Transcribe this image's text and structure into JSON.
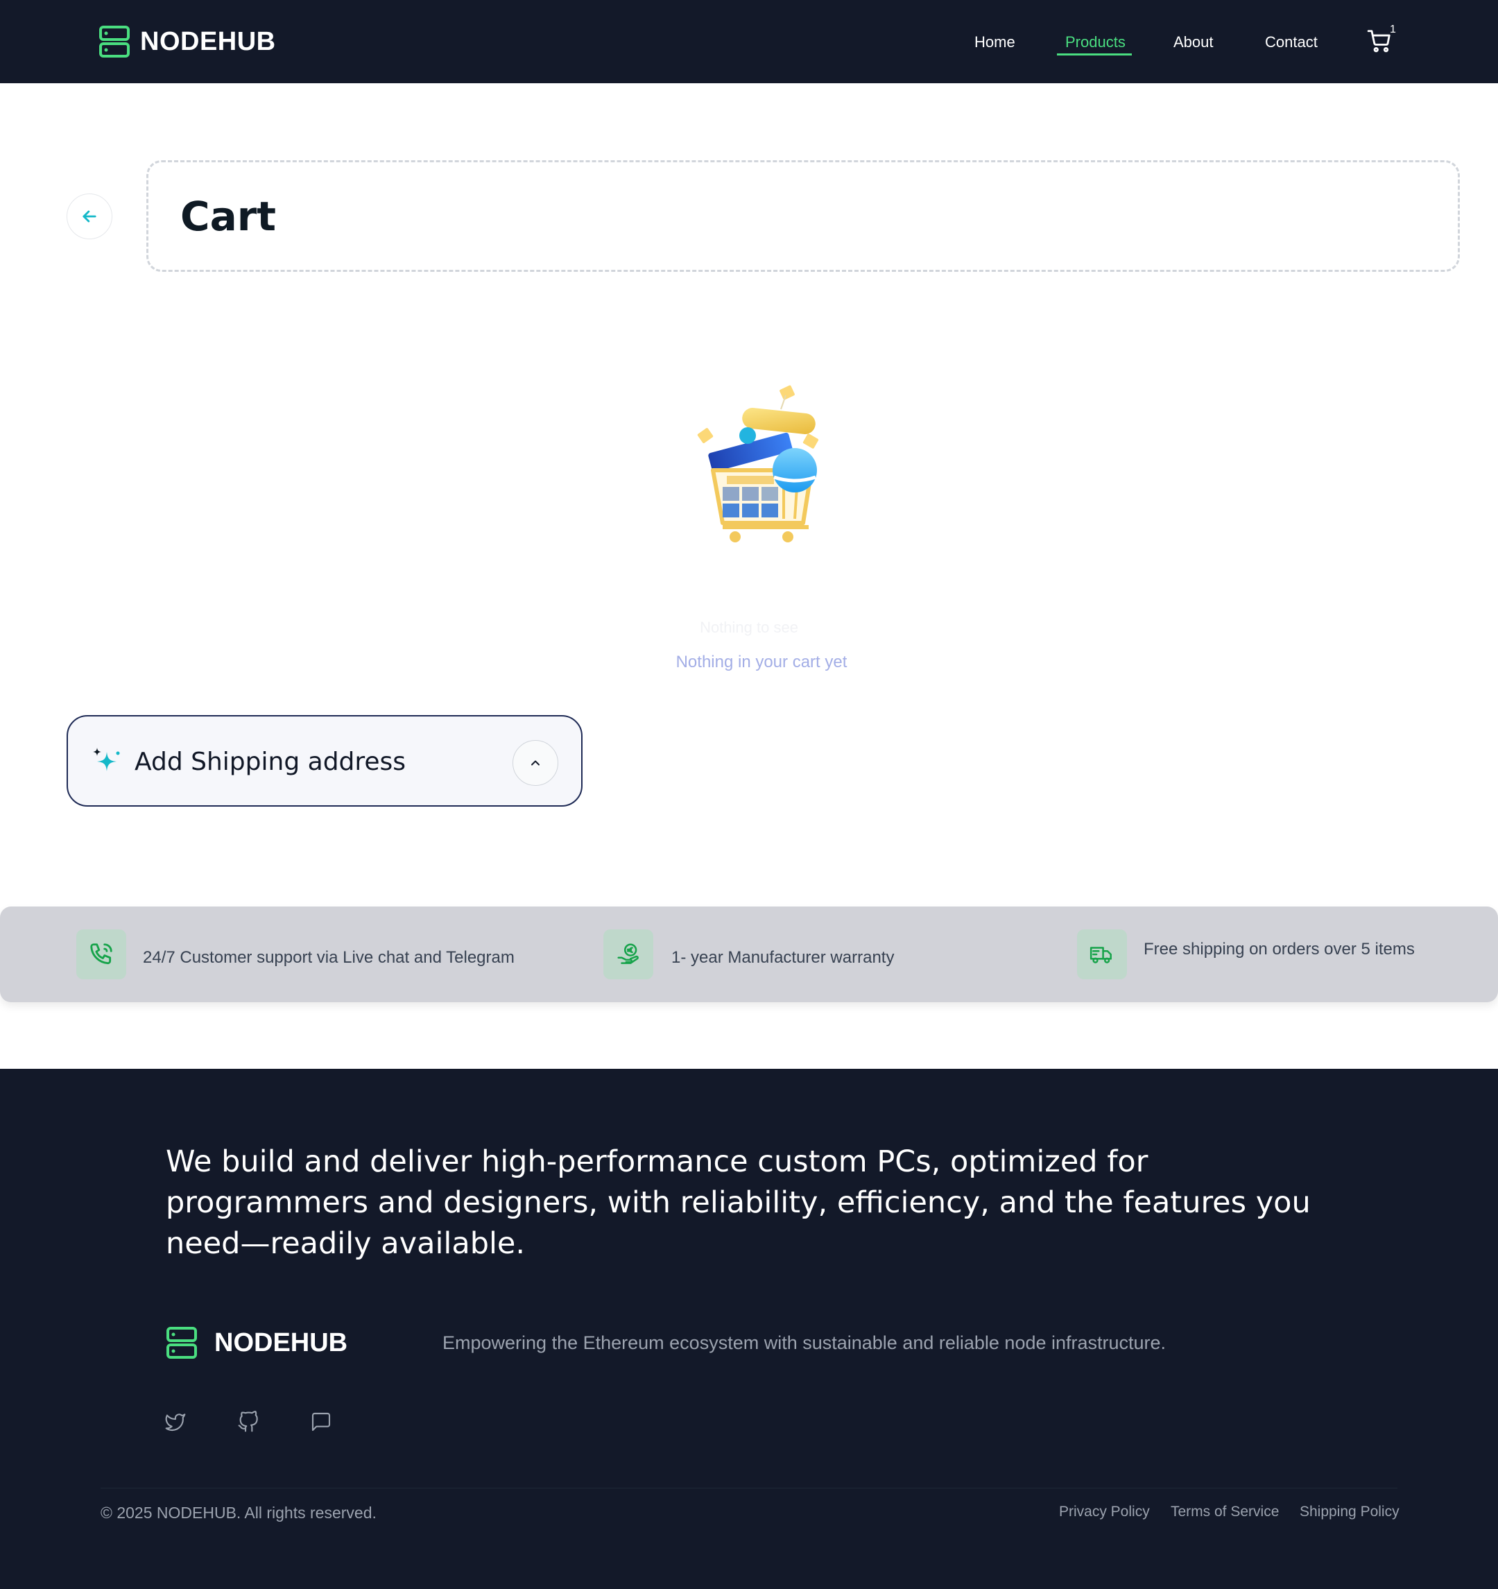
{
  "header": {
    "brand": "NODEHUB",
    "nav": [
      {
        "label": "Home",
        "active": false
      },
      {
        "label": "Products",
        "active": true
      },
      {
        "label": "About",
        "active": false
      },
      {
        "label": "Contact",
        "active": false
      }
    ],
    "cart_count": "1",
    "background": "#131929",
    "accent": "#4ade80"
  },
  "page": {
    "title": "Cart",
    "back_icon": "arrow-left-icon"
  },
  "empty_state": {
    "faded_text": "Nothing to see",
    "message": "Nothing in your cart yet",
    "illustration": "shopping-cart-illustration"
  },
  "shipping": {
    "label": "Add Shipping address",
    "icon": "sparkle-icon",
    "toggle_icon": "chevron-up-icon"
  },
  "features": [
    {
      "icon": "phone-icon",
      "text": "24/7 Customer support via Live chat and Telegram"
    },
    {
      "icon": "euro-hand-icon",
      "text": "1- year Manufacturer warranty"
    },
    {
      "icon": "truck-icon",
      "text": "Free shipping on orders over 5 items"
    }
  ],
  "footer": {
    "tagline": "We build and deliver high-performance custom PCs, optimized for programmers and designers, with reliability, efficiency, and the features you need—readily available.",
    "brand": "NODEHUB",
    "mission": "Empowering the Ethereum ecosystem with sustainable and reliable node infrastructure.",
    "social": [
      "twitter-icon",
      "github-icon",
      "chat-icon"
    ],
    "copyright": "© 2025 NODEHUB. All rights reserved.",
    "links": [
      "Privacy Policy",
      "Terms of Service",
      "Shipping Policy"
    ]
  }
}
